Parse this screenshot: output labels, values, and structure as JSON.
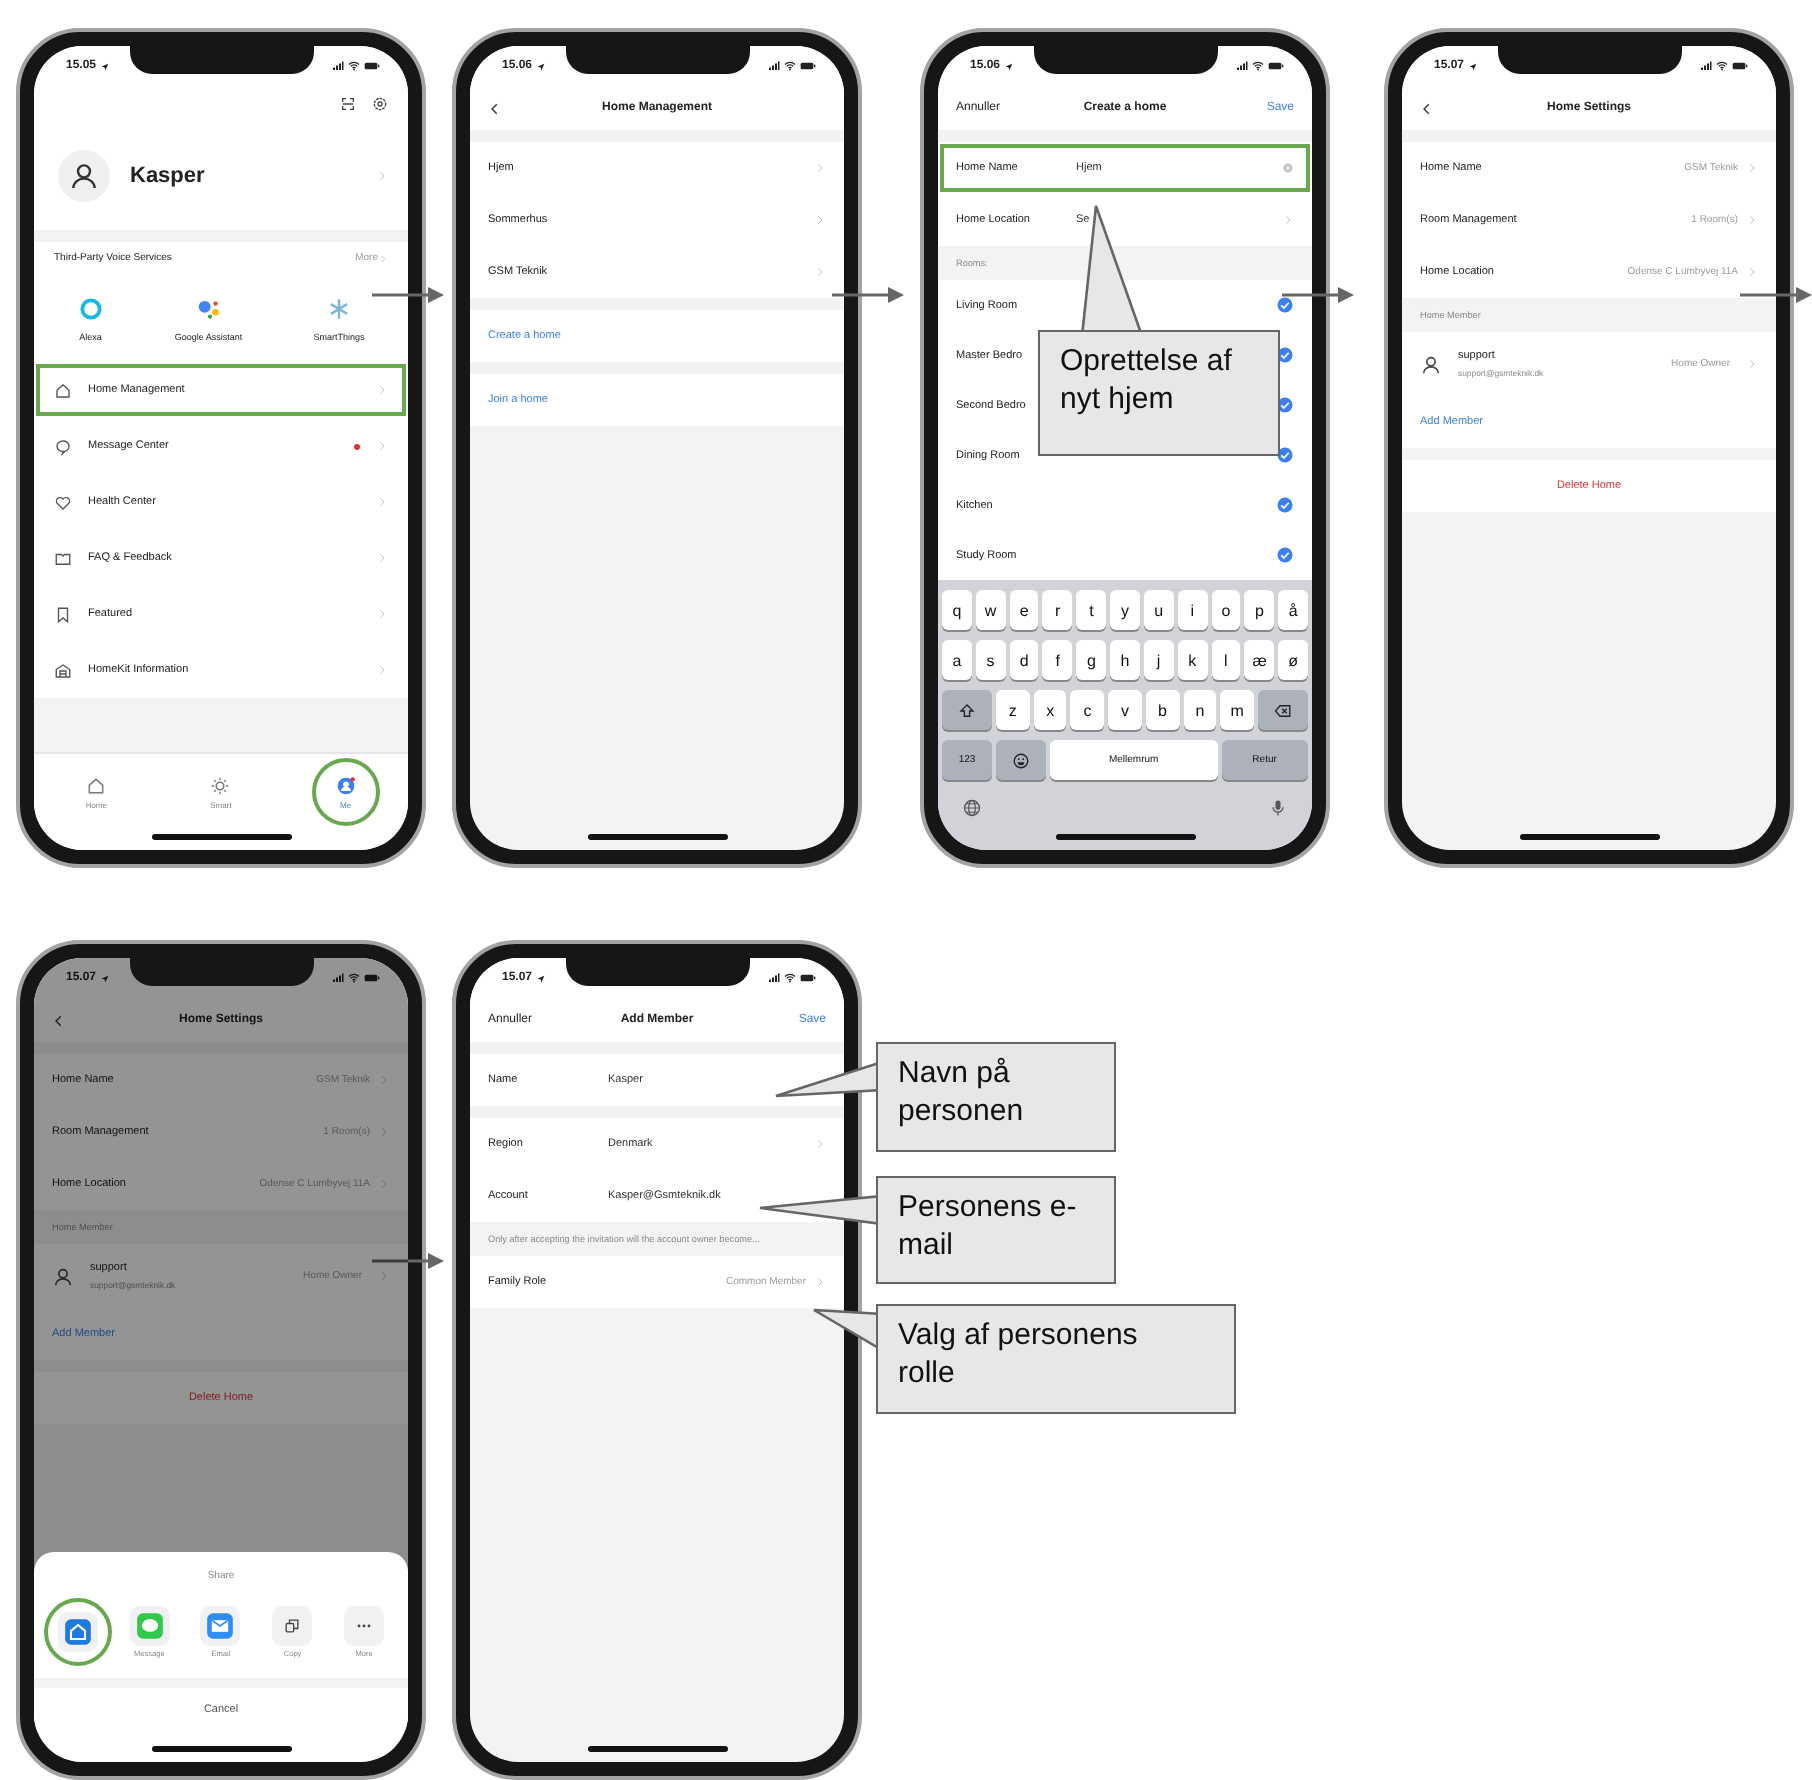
{
  "screens": [
    {
      "time": "15.05",
      "dimmed": false,
      "blocks": [
        {
          "kind": "header_icons"
        },
        {
          "kind": "profile",
          "name": "Kasper"
        },
        {
          "kind": "section_header",
          "label": "Third-Party Voice Services",
          "action": "More"
        },
        {
          "kind": "services",
          "items": [
            {
              "label": "Alexa",
              "kind": "ring"
            },
            {
              "label": "Google Assistant",
              "kind": "dots"
            },
            {
              "label": "SmartThings",
              "kind": "snowflake"
            }
          ]
        },
        {
          "kind": "menu",
          "items": [
            {
              "label": "Home Management",
              "kind": "house",
              "highlighted": true,
              "unread": false
            },
            {
              "label": "Message Center",
              "kind": "chat",
              "highlighted": false,
              "unread": true
            },
            {
              "label": "Health Center",
              "kind": "heart",
              "highlighted": false,
              "unread": false
            },
            {
              "label": "FAQ & Feedback",
              "kind": "book",
              "highlighted": false,
              "unread": false
            },
            {
              "label": "Featured",
              "kind": "bookmark",
              "highlighted": false,
              "unread": false
            },
            {
              "label": "HomeKit Information",
              "kind": "building",
              "highlighted": false,
              "unread": false
            }
          ]
        },
        {
          "kind": "tabbar",
          "items": [
            {
              "label": "Home",
              "kind": "house",
              "selected": false,
              "highlighted": false
            },
            {
              "label": "Smart",
              "kind": "sun",
              "selected": false,
              "highlighted": false
            },
            {
              "label": "Me",
              "kind": "me",
              "selected": true,
              "highlighted": true
            }
          ]
        }
      ]
    },
    {
      "time": "15.06",
      "dimmed": false,
      "blocks": [
        {
          "kind": "nav",
          "back": true,
          "title": "Home Management"
        },
        {
          "kind": "group",
          "rows": [
            {
              "kind": "row",
              "label": "Hjem",
              "chevron": true
            },
            {
              "kind": "row",
              "label": "Sommerhus",
              "chevron": true
            },
            {
              "kind": "row",
              "label": "GSM Teknik",
              "chevron": true
            }
          ]
        },
        {
          "kind": "group",
          "rows": [
            {
              "kind": "link",
              "label": "Create a home"
            }
          ]
        },
        {
          "kind": "group",
          "rows": [
            {
              "kind": "link",
              "label": "Join a home"
            }
          ]
        }
      ]
    },
    {
      "time": "15.06",
      "dimmed": false,
      "blocks": [
        {
          "kind": "nav",
          "back": false,
          "left": "Annuller",
          "title": "Create a home",
          "right": "Save"
        },
        {
          "kind": "group",
          "rows": [
            {
              "kind": "form",
              "label": "Home Name",
              "value": "Hjem",
              "chevron": false,
              "clear": true,
              "highlighted": true
            },
            {
              "kind": "form",
              "label": "Home Location",
              "value": "Se",
              "chevron": true,
              "clear": false,
              "highlighted": false
            }
          ]
        },
        {
          "kind": "caption",
          "text": "Rooms:"
        },
        {
          "kind": "group",
          "rows": [
            {
              "kind": "check",
              "label": "Living Room",
              "checked": true
            },
            {
              "kind": "check",
              "label": "Master Bedro",
              "checked": true
            },
            {
              "kind": "check",
              "label": "Second Bedro",
              "checked": true
            },
            {
              "kind": "check",
              "label": "Dining Room",
              "checked": true
            },
            {
              "kind": "check",
              "label": "Kitchen",
              "checked": true
            },
            {
              "kind": "check",
              "label": "Study Room",
              "checked": true
            }
          ]
        },
        {
          "kind": "keyboard",
          "rows": [
            {
              "keys": [
                {
                  "kind": "char",
                  "label": "q"
                },
                {
                  "kind": "char",
                  "label": "w"
                },
                {
                  "kind": "char",
                  "label": "e"
                },
                {
                  "kind": "char",
                  "label": "r"
                },
                {
                  "kind": "char",
                  "label": "t"
                },
                {
                  "kind": "char",
                  "label": "y"
                },
                {
                  "kind": "char",
                  "label": "u"
                },
                {
                  "kind": "char",
                  "label": "i"
                },
                {
                  "kind": "char",
                  "label": "o"
                },
                {
                  "kind": "char",
                  "label": "p"
                },
                {
                  "kind": "char",
                  "label": "å"
                }
              ]
            },
            {
              "keys": [
                {
                  "kind": "char",
                  "label": "a"
                },
                {
                  "kind": "char",
                  "label": "s"
                },
                {
                  "kind": "char",
                  "label": "d"
                },
                {
                  "kind": "char",
                  "label": "f"
                },
                {
                  "kind": "char",
                  "label": "g"
                },
                {
                  "kind": "char",
                  "label": "h"
                },
                {
                  "kind": "char",
                  "label": "j"
                },
                {
                  "kind": "char",
                  "label": "k"
                },
                {
                  "kind": "char",
                  "label": "l"
                },
                {
                  "kind": "char",
                  "label": "æ"
                },
                {
                  "kind": "char",
                  "label": "ø"
                }
              ]
            },
            {
              "keys": [
                {
                  "kind": "shift"
                },
                {
                  "kind": "char",
                  "label": "z"
                },
                {
                  "kind": "char",
                  "label": "x"
                },
                {
                  "kind": "char",
                  "label": "c"
                },
                {
                  "kind": "char",
                  "label": "v"
                },
                {
                  "kind": "char",
                  "label": "b"
                },
                {
                  "kind": "char",
                  "label": "n"
                },
                {
                  "kind": "char",
                  "label": "m"
                },
                {
                  "kind": "backspace"
                }
              ]
            },
            {
              "keys": [
                {
                  "kind": "mode",
                  "label": "123"
                },
                {
                  "kind": "emoji"
                },
                {
                  "kind": "space",
                  "label": "Mellemrum"
                },
                {
                  "kind": "return",
                  "label": "Retur"
                }
              ]
            }
          ]
        }
      ]
    },
    {
      "time": "15.07",
      "dimmed": false,
      "blocks": [
        {
          "kind": "nav",
          "back": true,
          "title": "Home Settings"
        },
        {
          "kind": "group",
          "rows": [
            {
              "kind": "row",
              "label": "Home Name",
              "value": "GSM Teknik",
              "chevron": true
            },
            {
              "kind": "row",
              "label": "Room Management",
              "value": "1 Room(s)",
              "chevron": true
            },
            {
              "kind": "row",
              "label": "Home Location",
              "value": "Odense C Lumbyvej 11A",
              "chevron": true
            }
          ]
        },
        {
          "kind": "caption",
          "text": "Home Member"
        },
        {
          "kind": "group",
          "rows": [
            {
              "kind": "member",
              "label": "support",
              "email": "support@gsmteknik.dk",
              "value": "Home Owner",
              "chevron": true
            },
            {
              "kind": "link",
              "label": "Add Member"
            }
          ]
        },
        {
          "kind": "group",
          "rows": [
            {
              "kind": "danger",
              "label": "Delete Home"
            }
          ]
        }
      ]
    },
    {
      "time": "15.07",
      "dimmed": true,
      "blocks": [
        {
          "kind": "nav",
          "back": true,
          "title": "Home Settings"
        },
        {
          "kind": "group",
          "rows": [
            {
              "kind": "row",
              "label": "Home Name",
              "value": "GSM Teknik",
              "chevron": true
            },
            {
              "kind": "row",
              "label": "Room Management",
              "value": "1 Room(s)",
              "chevron": true
            },
            {
              "kind": "row",
              "label": "Home Location",
              "value": "Odense C Lumbyvej 11A",
              "chevron": true
            }
          ]
        },
        {
          "kind": "caption",
          "text": "Home Member"
        },
        {
          "kind": "group",
          "rows": [
            {
              "kind": "member",
              "label": "support",
              "email": "support@gsmteknik.dk",
              "value": "Home Owner",
              "chevron": true
            },
            {
              "kind": "link",
              "label": "Add Member"
            }
          ]
        },
        {
          "kind": "group",
          "rows": [
            {
              "kind": "danger",
              "label": "Delete Home"
            }
          ]
        },
        {
          "kind": "share",
          "title": "Share",
          "cancel": "Cancel",
          "items": [
            {
              "kind": "app",
              "highlighted": true
            },
            {
              "label": "Message",
              "kind": "message",
              "highlighted": false
            },
            {
              "label": "Email",
              "kind": "mail",
              "highlighted": false
            },
            {
              "label": "Copy",
              "kind": "copy",
              "highlighted": false
            },
            {
              "label": "More",
              "kind": "more",
              "highlighted": false
            }
          ]
        }
      ]
    },
    {
      "time": "15.07",
      "dimmed": false,
      "blocks": [
        {
          "kind": "nav",
          "back": false,
          "left": "Annuller",
          "title": "Add Member",
          "right": "Save"
        },
        {
          "kind": "group",
          "rows": [
            {
              "kind": "form",
              "label": "Name",
              "value": "Kasper",
              "chevron": false,
              "clear": false,
              "highlighted": false
            }
          ]
        },
        {
          "kind": "group",
          "rows": [
            {
              "kind": "form",
              "label": "Region",
              "value": "Denmark",
              "chevron": true,
              "clear": false,
              "highlighted": false
            },
            {
              "kind": "form",
              "label": "Account",
              "value": "Kasper@Gsmteknik.dk",
              "chevron": false,
              "clear": false,
              "highlighted": false
            }
          ]
        },
        {
          "kind": "caption",
          "text": "Only after accepting the invitation will the account owner become..."
        },
        {
          "kind": "group",
          "rows": [
            {
              "kind": "row",
              "label": "Family Role",
              "value": "Common Member",
              "chevron": true
            }
          ]
        }
      ]
    }
  ],
  "callouts": [
    {
      "text": "Oprettelse af nyt hjem"
    },
    {
      "text": "Navn på personen"
    },
    {
      "text": "Personens e-mail"
    },
    {
      "text": "Valg af personens rolle"
    }
  ]
}
